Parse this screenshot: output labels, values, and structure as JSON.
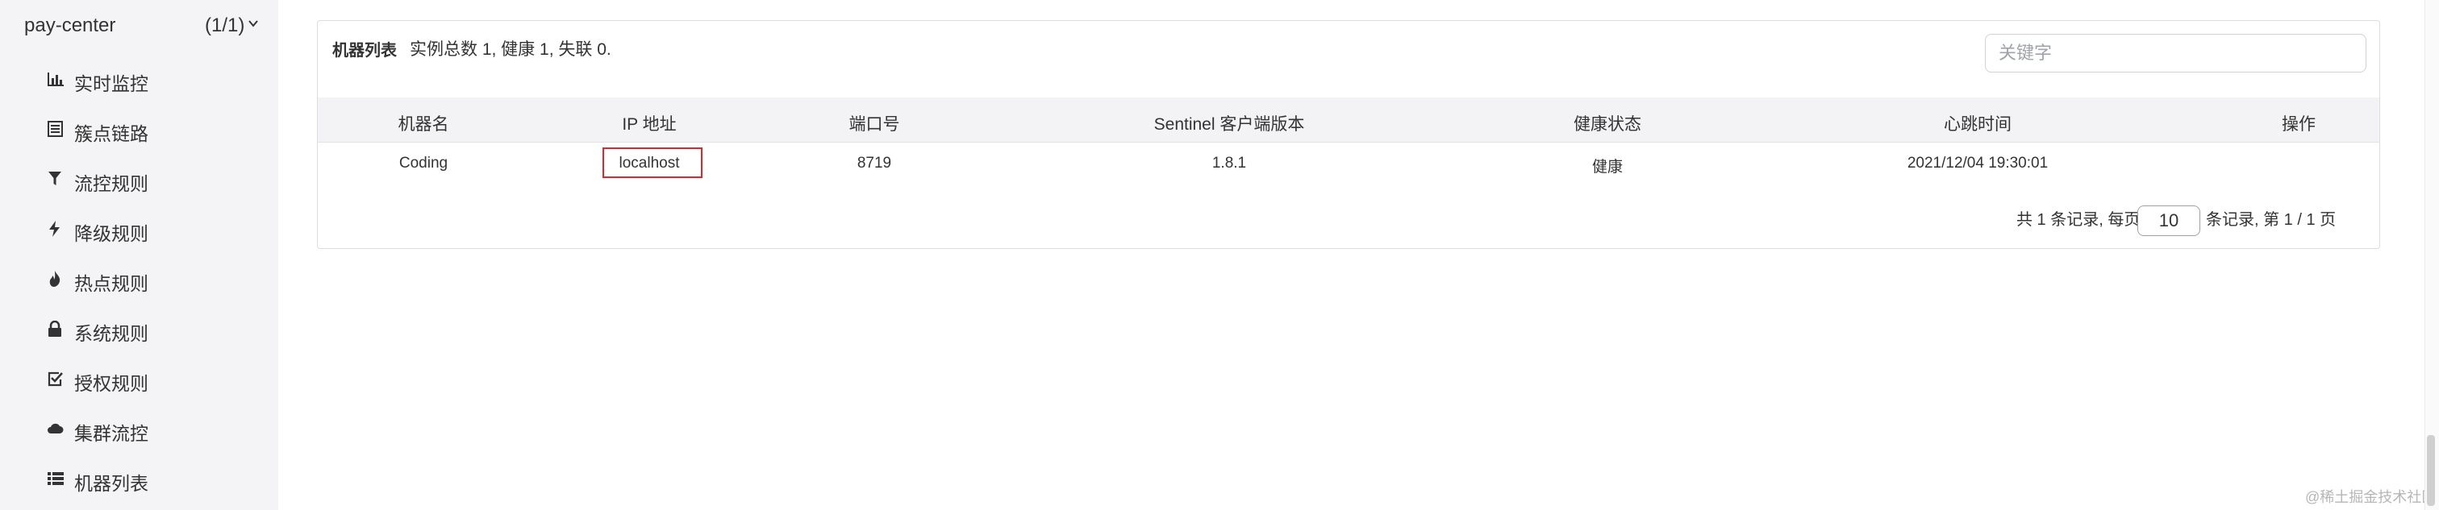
{
  "sidebar": {
    "app_name": "pay-center",
    "app_count": "(1/1)",
    "items": [
      {
        "label": "实时监控",
        "icon": "bar-chart-icon"
      },
      {
        "label": "簇点链路",
        "icon": "list-table-icon"
      },
      {
        "label": "流控规则",
        "icon": "filter-icon"
      },
      {
        "label": "降级规则",
        "icon": "flash-icon"
      },
      {
        "label": "热点规则",
        "icon": "fire-icon"
      },
      {
        "label": "系统规则",
        "icon": "lock-icon"
      },
      {
        "label": "授权规则",
        "icon": "check-square-icon"
      },
      {
        "label": "集群流控",
        "icon": "cloud-icon"
      },
      {
        "label": "机器列表",
        "icon": "list-icon"
      }
    ]
  },
  "panel": {
    "title": "机器列表",
    "summary": "实例总数 1, 健康 1, 失联 0.",
    "search_placeholder": "关键字",
    "columns": [
      "机器名",
      "IP 地址",
      "端口号",
      "Sentinel 客户端版本",
      "健康状态",
      "心跳时间",
      "操作"
    ],
    "rows": [
      {
        "machine": "Coding",
        "ip": "localhost",
        "port": "8719",
        "version": "1.8.1",
        "health": "健康",
        "heartbeat": "2021/12/04 19:30:01",
        "action": ""
      }
    ],
    "pagination": {
      "prefix": "共 1 条记录, 每页",
      "page_size": "10",
      "suffix": "条记录, 第 1 / 1 页"
    }
  },
  "watermark": "@稀土掘金技术社区",
  "colors": {
    "highlight_box": "#e0262b",
    "sidebar_bg": "#f4f4f6",
    "table_header_bg": "#f3f3f5"
  }
}
